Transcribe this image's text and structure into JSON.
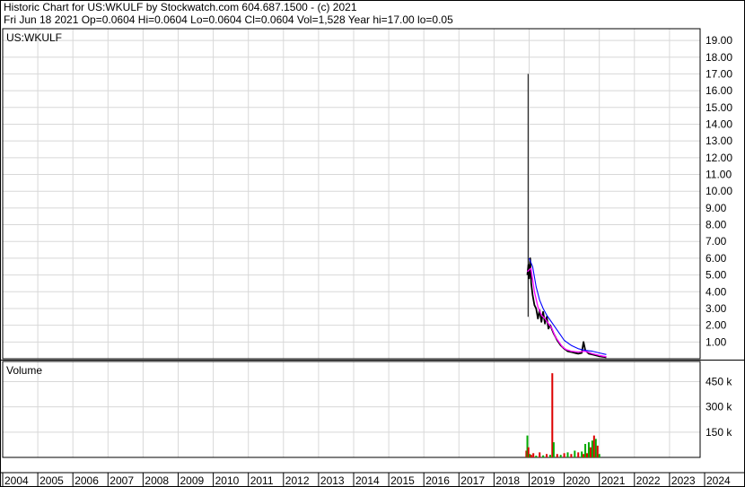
{
  "header": {
    "line1": "Historic Chart for US:WKULF by Stockwatch.com 604.687.1500 - (c) 2021",
    "line2": "Fri Jun 18 2021   Op=0.0604   Hi=0.0604   Lo=0.0604   Cl=0.0604   Vol=1,528   Year hi=17.00   lo=0.05"
  },
  "chart_data": {
    "type": "line",
    "price_panel_label": "US:WKULF",
    "volume_panel_label": "Volume",
    "x_axis": {
      "range": [
        2004,
        2024
      ],
      "tick_labels": [
        "2004",
        "2005",
        "2006",
        "2007",
        "2008",
        "2009",
        "2010",
        "2011",
        "2012",
        "2013",
        "2014",
        "2015",
        "2016",
        "2017",
        "2018",
        "2019",
        "2020",
        "2021",
        "2022",
        "2023",
        "2024"
      ]
    },
    "price_axis": {
      "range": [
        0,
        19.7
      ],
      "tick_labels": [
        "19.00",
        "18.00",
        "17.00",
        "16.00",
        "15.00",
        "14.00",
        "13.00",
        "12.00",
        "11.00",
        "10.00",
        "9.00",
        "8.00",
        "7.00",
        "6.00",
        "5.00",
        "4.00",
        "3.00",
        "2.00",
        "1.00"
      ]
    },
    "volume_axis": {
      "range": [
        0,
        570000
      ],
      "tick_labels": [
        "450 k",
        "300 k",
        "150 k"
      ]
    },
    "colors": {
      "price": "#000000",
      "ma_short": "#ff00ff",
      "ma_long": "#0000ff",
      "volume_up": "#00aa00",
      "volume_down": "#dd0000",
      "grid": "#d8d8d8"
    },
    "series": [
      {
        "values_kind": "price",
        "x": [
          2018.95,
          2018.98,
          2019.0,
          2019.03,
          2019.06,
          2019.1,
          2019.15,
          2019.2,
          2019.25,
          2019.3,
          2019.35,
          2019.4,
          2019.45,
          2019.5,
          2019.55,
          2019.6,
          2019.7,
          2019.8,
          2019.9,
          2020.0,
          2020.1,
          2020.2,
          2020.3,
          2020.4,
          2020.5,
          2020.55,
          2020.6,
          2020.7,
          2020.8,
          2020.9,
          2021.0,
          2021.1,
          2021.2
        ],
        "y": [
          5.0,
          5.6,
          4.8,
          6.0,
          4.5,
          3.8,
          3.2,
          3.0,
          2.4,
          2.9,
          2.2,
          2.8,
          2.1,
          2.5,
          1.8,
          2.0,
          1.5,
          1.1,
          0.8,
          0.6,
          0.45,
          0.4,
          0.35,
          0.3,
          0.35,
          1.0,
          0.5,
          0.3,
          0.25,
          0.2,
          0.15,
          0.12,
          0.08
        ]
      },
      {
        "values_kind": "ma_short",
        "x": [
          2018.95,
          2019.05,
          2019.15,
          2019.25,
          2019.35,
          2019.45,
          2019.55,
          2019.65,
          2019.75,
          2019.85,
          2019.95,
          2020.05,
          2020.2,
          2020.4,
          2020.6,
          2020.8,
          2021.0,
          2021.2
        ],
        "y": [
          5.2,
          5.4,
          4.0,
          3.1,
          2.6,
          2.4,
          2.1,
          1.8,
          1.3,
          1.0,
          0.7,
          0.55,
          0.45,
          0.4,
          0.45,
          0.3,
          0.2,
          0.12
        ]
      },
      {
        "values_kind": "ma_long",
        "x": [
          2019.0,
          2019.1,
          2019.2,
          2019.3,
          2019.4,
          2019.5,
          2019.6,
          2019.7,
          2019.8,
          2019.9,
          2020.0,
          2020.2,
          2020.4,
          2020.6,
          2020.8,
          2021.0,
          2021.2
        ],
        "y": [
          6.0,
          5.5,
          4.3,
          3.5,
          3.0,
          2.6,
          2.3,
          2.0,
          1.7,
          1.4,
          1.1,
          0.8,
          0.6,
          0.5,
          0.45,
          0.35,
          0.25
        ]
      }
    ],
    "spike": {
      "x": 2018.97,
      "high": 17.0,
      "low": 2.5
    },
    "volume": {
      "x": [
        2018.92,
        2018.95,
        2018.98,
        2019.02,
        2019.06,
        2019.12,
        2019.2,
        2019.3,
        2019.4,
        2019.5,
        2019.6,
        2019.66,
        2019.7,
        2019.8,
        2019.9,
        2020.0,
        2020.1,
        2020.2,
        2020.3,
        2020.4,
        2020.5,
        2020.55,
        2020.6,
        2020.65,
        2020.7,
        2020.75,
        2020.8,
        2020.85,
        2020.9,
        2020.95,
        2021.0
      ],
      "values": [
        40000,
        130000,
        60000,
        20000,
        15000,
        25000,
        10000,
        30000,
        12000,
        20000,
        15000,
        500000,
        90000,
        20000,
        15000,
        25000,
        30000,
        20000,
        40000,
        30000,
        35000,
        20000,
        80000,
        25000,
        90000,
        60000,
        100000,
        130000,
        110000,
        70000,
        20000
      ],
      "up": [
        false,
        true,
        false,
        true,
        false,
        false,
        true,
        false,
        true,
        false,
        true,
        false,
        true,
        false,
        true,
        false,
        true,
        false,
        true,
        false,
        true,
        false,
        true,
        false,
        true,
        false,
        true,
        false,
        true,
        false,
        true
      ]
    },
    "grid": true,
    "legend": "none"
  }
}
